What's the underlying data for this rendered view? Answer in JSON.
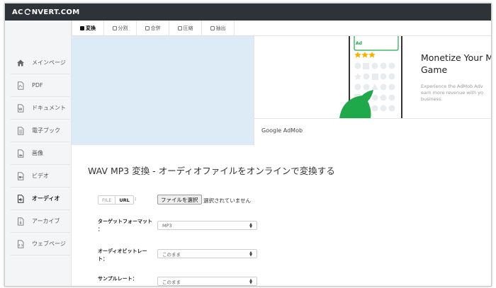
{
  "header": {
    "logo_left": "AC",
    "logo_right": "NVERT.COM"
  },
  "sidebar": {
    "items": [
      {
        "label": "メインページ",
        "icon": "home-icon"
      },
      {
        "label": "PDF",
        "icon": "pdf-icon"
      },
      {
        "label": "ドキュメント",
        "icon": "document-icon"
      },
      {
        "label": "電子ブック",
        "icon": "ebook-icon"
      },
      {
        "label": "画像",
        "icon": "image-icon"
      },
      {
        "label": "ビデオ",
        "icon": "video-icon"
      },
      {
        "label": "オーディオ",
        "icon": "audio-icon"
      },
      {
        "label": "アーカイブ",
        "icon": "archive-icon"
      },
      {
        "label": "ウェブページ",
        "icon": "webpage-icon"
      }
    ],
    "active_index": 6
  },
  "tabs": [
    {
      "label": "変換"
    },
    {
      "label": "分割"
    },
    {
      "label": "合併"
    },
    {
      "label": "圧縮"
    },
    {
      "label": "抽出"
    }
  ],
  "ad": {
    "title": "Monetize Your M Game",
    "desc_line1": "Experience the AdMob Adv",
    "desc_line2": "earn more revenue with yo",
    "desc_line3": "business.",
    "caption": "Google AdMob",
    "phone_badge": "Ad",
    "star_color": "#f5b400",
    "accent_green": "#20a94a"
  },
  "page": {
    "title": "WAV MP3 変換 - オーディオファイルをオンラインで変換する"
  },
  "form": {
    "file_tab": "FILE",
    "url_tab": "URL",
    "colon": ":",
    "file_button": "ファイルを選択",
    "file_status": "選択されていません",
    "target_label_1": "ターゲットフォーマット",
    "target_label_2": "：",
    "target_value": "MP3",
    "bitrate_label_1": "オーディオビットレー",
    "bitrate_label_2": "ト：",
    "bitrate_value": "このまま",
    "sample_label": "サンプルレート：",
    "sample_value": "このまま"
  }
}
